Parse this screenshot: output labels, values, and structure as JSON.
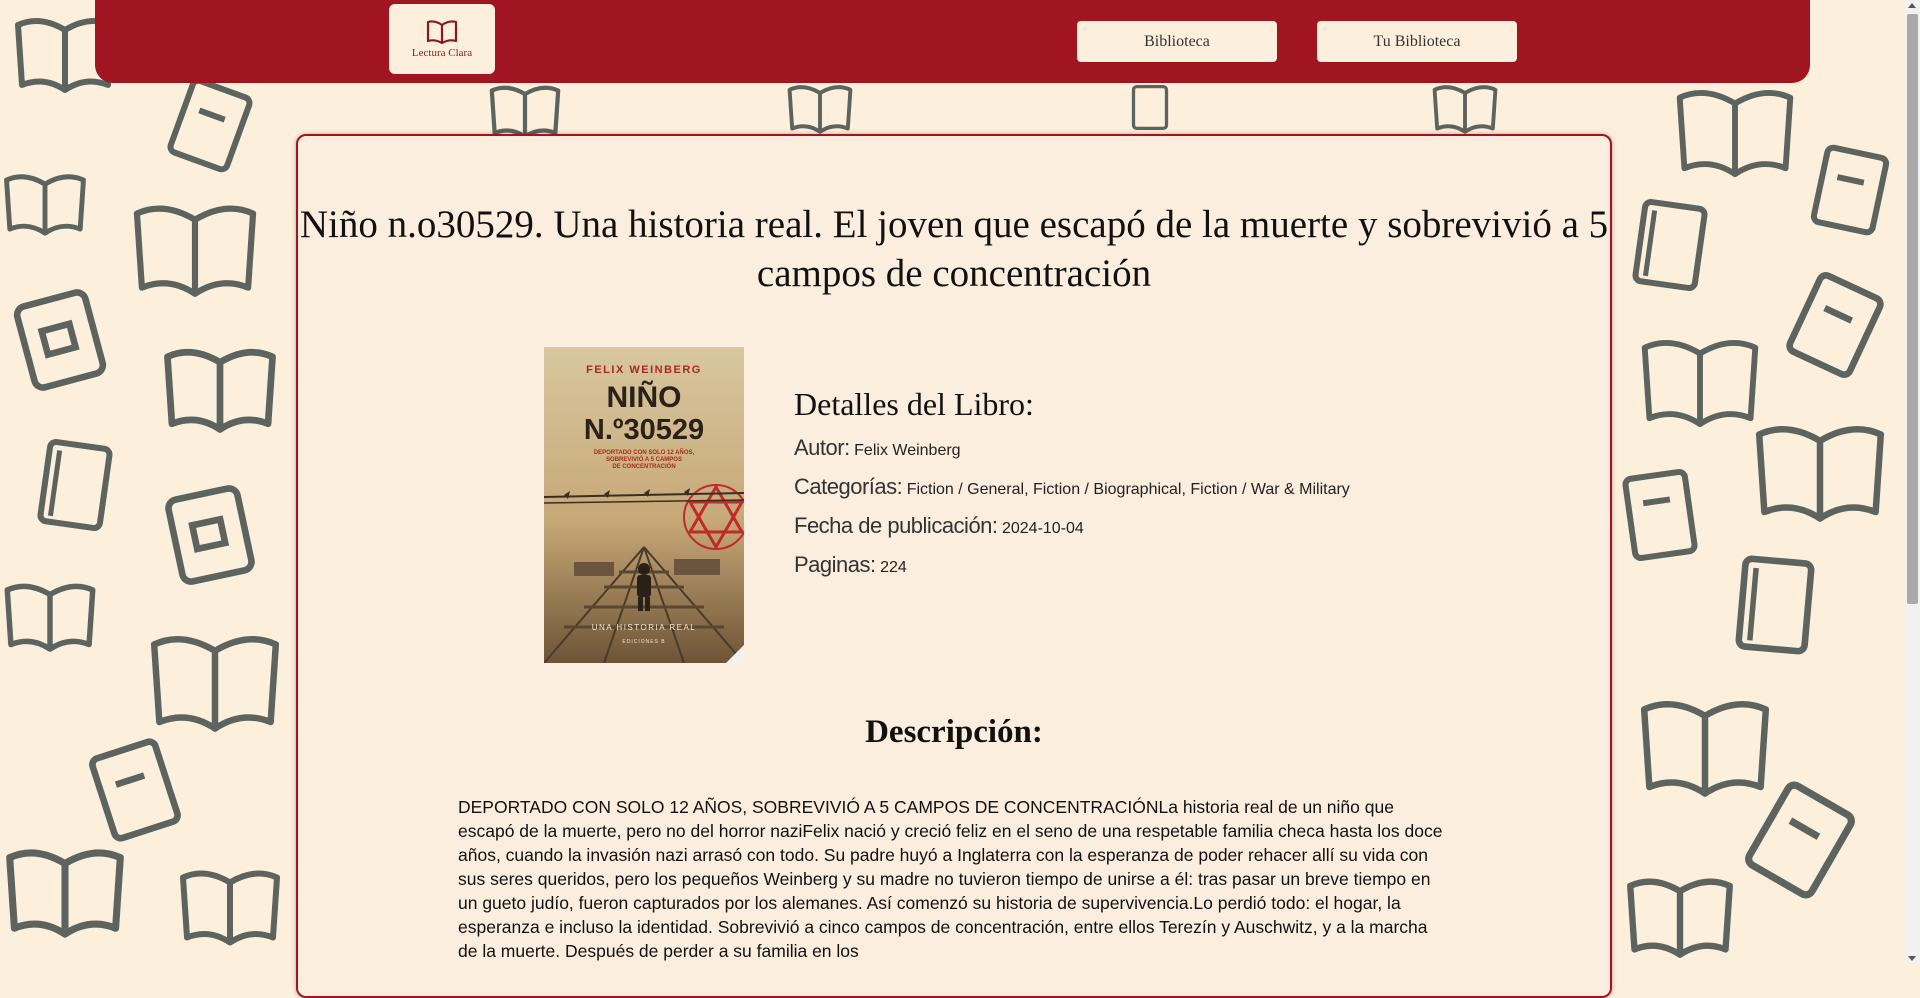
{
  "nav": {
    "logo_text": "Lectura Clara",
    "links": [
      {
        "label": "Biblioteca"
      },
      {
        "label": "Tu Biblioteca"
      }
    ]
  },
  "book": {
    "title": "Niño n.o30529. Una historia real. El joven que escapó de la muerte y sobrevivió a 5 campos de concentración",
    "cover": {
      "author": "FELIX WEINBERG",
      "title_line1": "NIÑO",
      "title_line2": "N.º30529",
      "tagline_line1": "DEPORTADO CON SOLO 12 AÑOS,",
      "tagline_line2": "SOBREVIVIÓ A 5 CAMPOS",
      "tagline_line3": "DE CONCENTRACIÓN",
      "bottom_text": "UNA HISTORIA REAL",
      "publisher": "EDICIONES B"
    },
    "details_heading": "Detalles del Libro:",
    "author_label": "Autor:",
    "author": "Felix Weinberg",
    "categories_label": "Categorías:",
    "categories": "Fiction / General, Fiction / Biographical, Fiction / War & Military",
    "published_label": "Fecha de publicación:",
    "published": "2024-10-04",
    "pages_label": "Paginas:",
    "pages": "224",
    "description_heading": "Descripción:",
    "description": "DEPORTADO CON SOLO 12 AÑOS, SOBREVIVIÓ A 5 CAMPOS DE CONCENTRACIÓNLa historia real de un niño que escapó de la muerte, pero no del horror naziFelix nació y creció feliz en el seno de una respetable familia checa hasta los doce años, cuando la invasión nazi arrasó con todo. Su padre huyó a Inglaterra con la esperanza de poder rehacer allí su vida con sus seres queridos, pero los pequeños Weinberg y su madre no tuvieron tiempo de unirse a él: tras pasar un breve tiempo en un gueto judío, fueron capturados por los alemanes. Así comenzó su historia de supervivencia.Lo perdió todo: el hogar, la esperanza e incluso la identidad. Sobrevivió a cinco campos de concentración, entre ellos Terezín y Auschwitz, y a la marcha de la muerte. Después de perder a su familia en los"
  }
}
